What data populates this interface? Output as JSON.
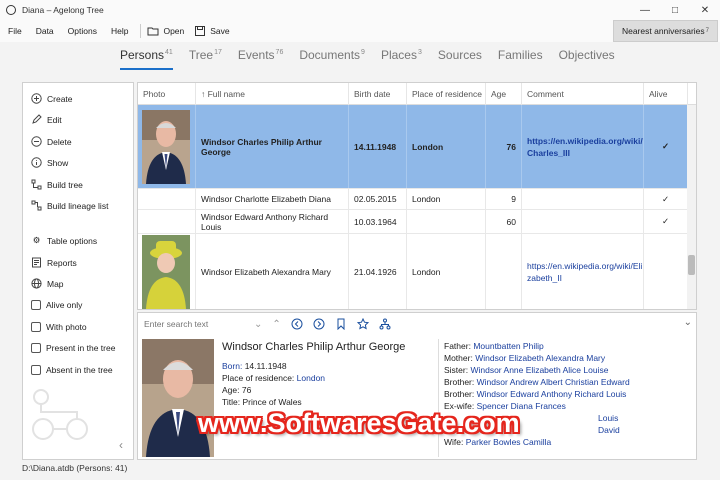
{
  "window": {
    "title": "Diana – Agelong Tree",
    "controls": [
      "minimize-icon",
      "maximize-icon",
      "close-icon"
    ]
  },
  "menu": {
    "items": [
      "File",
      "Data",
      "Options",
      "Help"
    ],
    "open_label": "Open",
    "save_label": "Save",
    "nearest_label": "Nearest anniversaries",
    "nearest_count": "7"
  },
  "tabs": [
    {
      "label": "Persons",
      "count": "41"
    },
    {
      "label": "Tree",
      "count": "17"
    },
    {
      "label": "Events",
      "count": "76"
    },
    {
      "label": "Documents",
      "count": "9"
    },
    {
      "label": "Places",
      "count": "3"
    },
    {
      "label": "Sources",
      "count": ""
    },
    {
      "label": "Families",
      "count": ""
    },
    {
      "label": "Objectives",
      "count": ""
    }
  ],
  "sidebar": {
    "actions": [
      {
        "label": "Create",
        "icon": "plus-circle-icon"
      },
      {
        "label": "Edit",
        "icon": "pencil-icon"
      },
      {
        "label": "Delete",
        "icon": "minus-circle-icon"
      },
      {
        "label": "Show",
        "icon": "info-circle-icon"
      },
      {
        "label": "Build tree",
        "icon": "tree-icon"
      },
      {
        "label": "Build lineage list",
        "icon": "lineage-icon"
      }
    ],
    "tools": [
      {
        "label": "Table options",
        "icon": "gear-icon"
      },
      {
        "label": "Reports",
        "icon": "report-icon"
      },
      {
        "label": "Map",
        "icon": "globe-icon"
      }
    ],
    "filters": [
      {
        "label": "Alive only",
        "checked": false
      },
      {
        "label": "With photo",
        "checked": false
      },
      {
        "label": "Present in the tree",
        "checked": false
      },
      {
        "label": "Absent in the tree",
        "checked": false
      }
    ]
  },
  "table": {
    "columns": [
      "Photo",
      "↑ Full name",
      "Birth date",
      "Place of residence",
      "Age",
      "Comment",
      "Alive"
    ],
    "rows": [
      {
        "name": "Windsor Charles Philip Arthur George",
        "birth": "14.11.1948",
        "place": "London",
        "age": "76",
        "comment": "https://en.wikipedia.org/wiki/Charles_III",
        "alive": "✓",
        "photo": "man"
      },
      {
        "name": "Windsor Charlotte Elizabeth Diana",
        "birth": "02.05.2015",
        "place": "London",
        "age": "9",
        "comment": "",
        "alive": "✓",
        "photo": ""
      },
      {
        "name": "Windsor Edward Anthony Richard Louis",
        "birth": "10.03.1964",
        "place": "",
        "age": "60",
        "comment": "",
        "alive": "✓",
        "photo": ""
      },
      {
        "name": "Windsor Elizabeth Alexandra Mary",
        "birth": "21.04.1926",
        "place": "London",
        "age": "",
        "comment": "https://en.wikipedia.org/wiki/Elizabeth_II",
        "alive": "",
        "photo": "woman"
      }
    ]
  },
  "detail": {
    "search_placeholder": "Enter search text",
    "name": "Windsor Charles Philip Arthur George",
    "born_label": "Born:",
    "born_value": "14.11.1948",
    "residence_label": "Place of residence:",
    "residence_value": "London",
    "age_line": "Age: 76",
    "title_line": "Title: Prince of Wales",
    "relations": [
      {
        "label": "Father:",
        "value": "Mountbatten Philip"
      },
      {
        "label": "Mother:",
        "value": "Windsor Elizabeth Alexandra Mary"
      },
      {
        "label": "Sister:",
        "value": "Windsor Anne Elizabeth Alice Louise"
      },
      {
        "label": "Brother:",
        "value": "Windsor Andrew Albert Christian Edward"
      },
      {
        "label": "Brother:",
        "value": "Windsor Edward Anthony Richard Louis"
      },
      {
        "label": "Ex-wife:",
        "value": "Spencer Diana Frances"
      },
      {
        "label": "",
        "value": "Louis"
      },
      {
        "label": "",
        "value": "David"
      },
      {
        "label": "Wife:",
        "value": "Parker Bowles Camilla"
      }
    ]
  },
  "watermark": "www.SoftwaresGate.com",
  "status": "D:\\Diana.atdb (Persons: 41)"
}
